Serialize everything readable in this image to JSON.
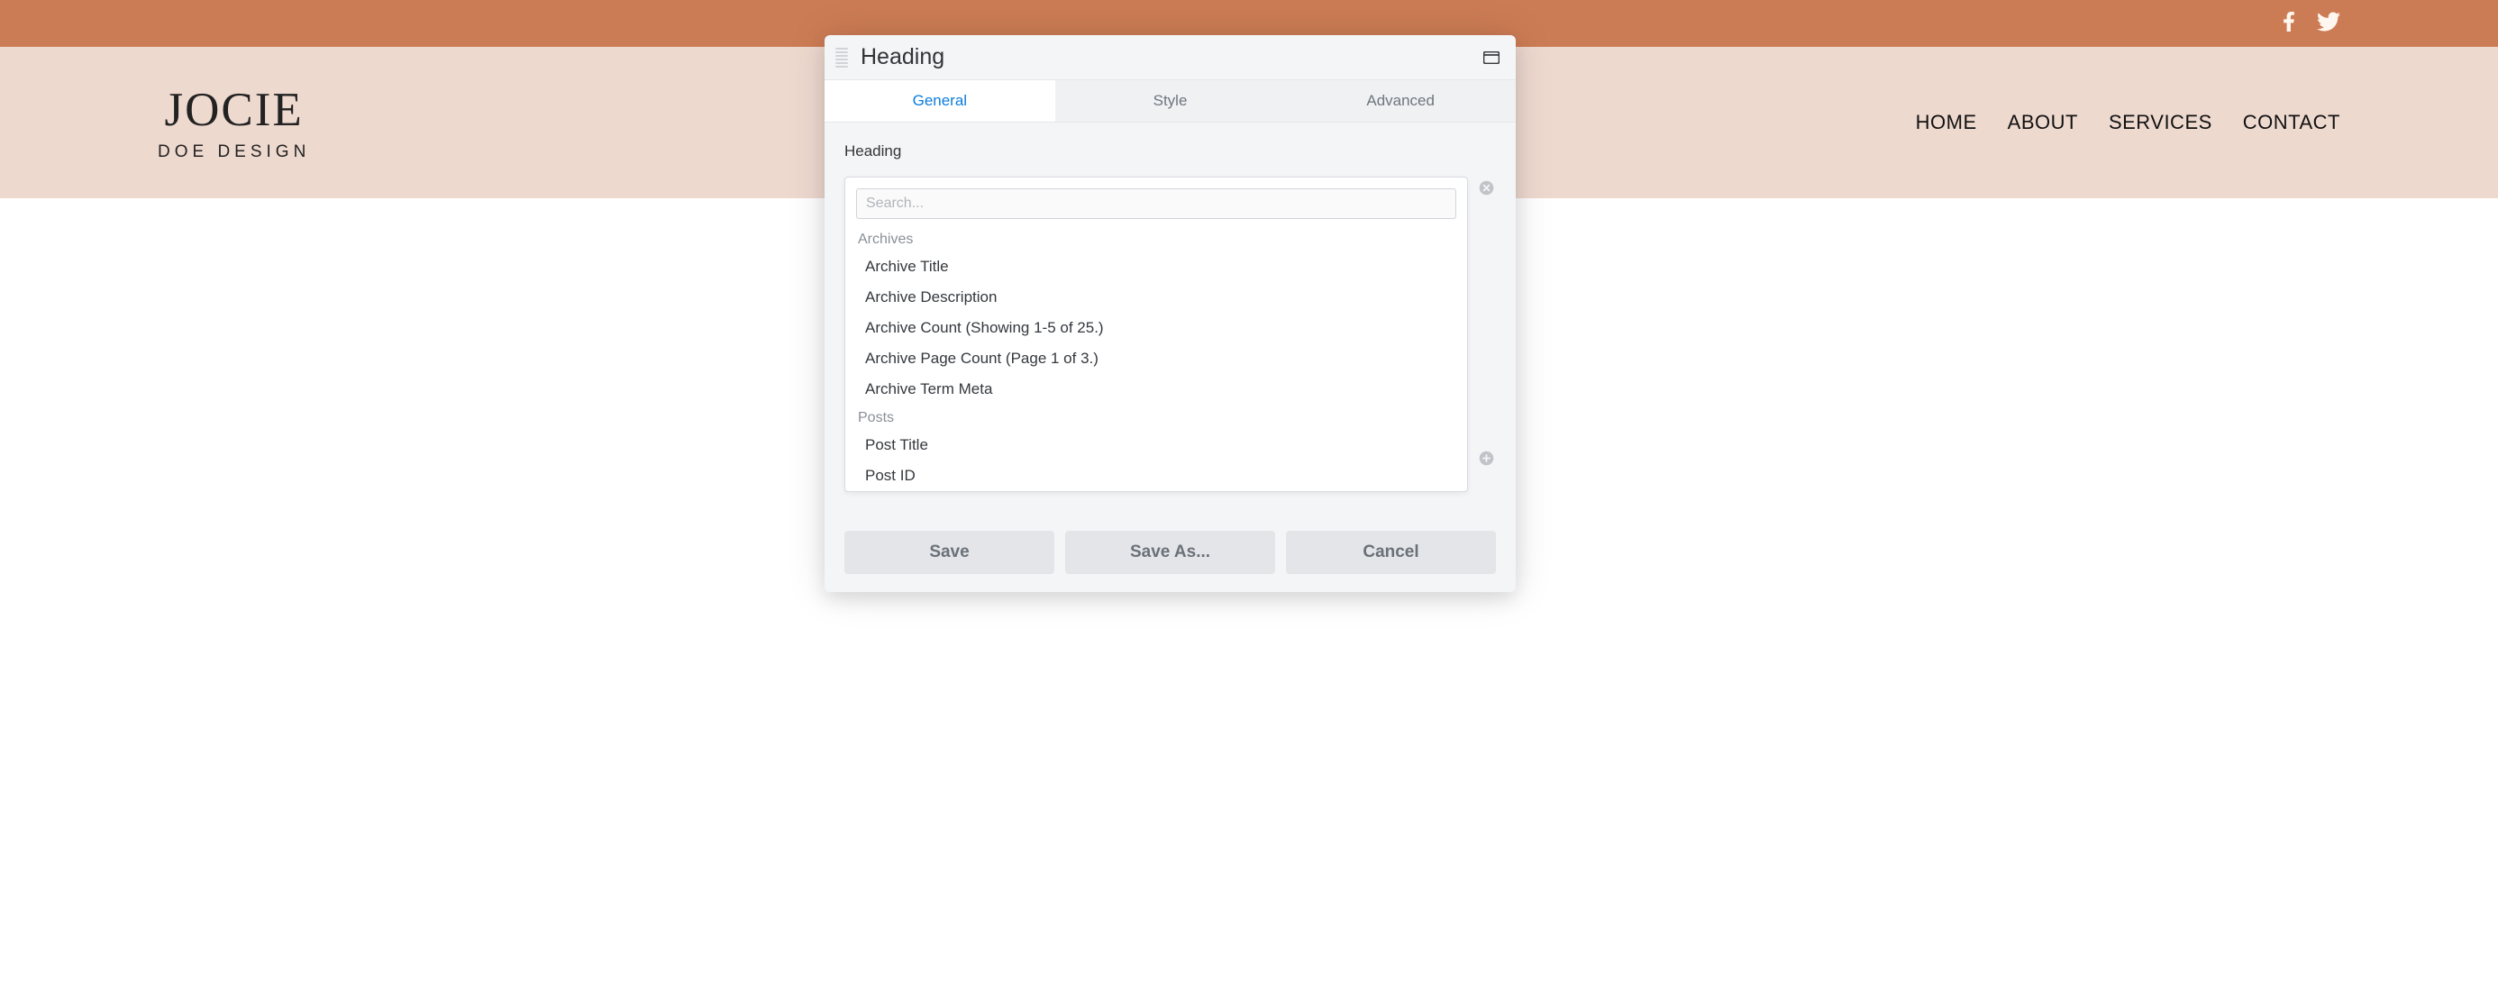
{
  "site": {
    "brand_title": "JOCIE",
    "brand_subtitle": "DOE DESIGN",
    "nav": [
      {
        "label": "HOME"
      },
      {
        "label": "ABOUT"
      },
      {
        "label": "SERVICES"
      },
      {
        "label": "CONTACT"
      }
    ]
  },
  "social": {
    "facebook": "facebook-icon",
    "twitter": "twitter-icon"
  },
  "panel": {
    "title": "Heading",
    "tabs": [
      {
        "label": "General",
        "active": true
      },
      {
        "label": "Style",
        "active": false
      },
      {
        "label": "Advanced",
        "active": false
      }
    ],
    "section_label": "Heading",
    "search_placeholder": "Search...",
    "groups": [
      {
        "label": "Archives",
        "items": [
          "Archive Title",
          "Archive Description",
          "Archive Count (Showing 1-5 of 25.)",
          "Archive Page Count (Page 1 of 3.)",
          "Archive Term Meta"
        ]
      },
      {
        "label": "Posts",
        "items": [
          "Post Title",
          "Post ID"
        ]
      }
    ],
    "buttons": {
      "save": "Save",
      "save_as": "Save As...",
      "cancel": "Cancel"
    }
  }
}
